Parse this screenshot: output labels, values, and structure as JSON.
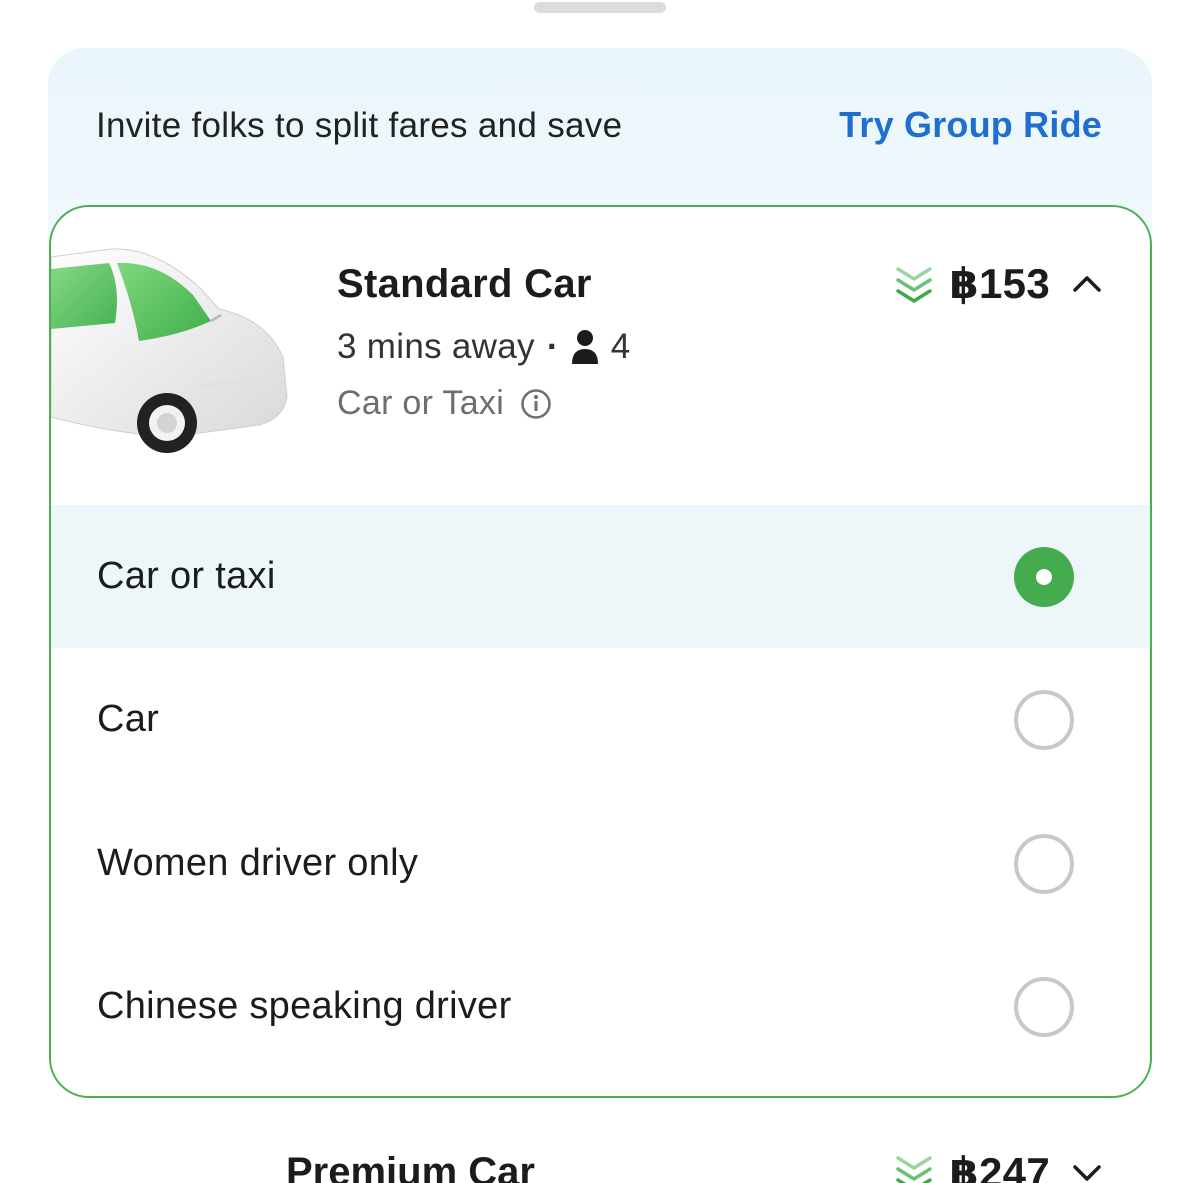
{
  "banner": {
    "text": "Invite folks to split fares and save",
    "link": "Try Group Ride"
  },
  "selected_ride": {
    "name": "Standard Car",
    "eta": "3 mins away",
    "separator": "·",
    "seats": "4",
    "category": "Car or Taxi",
    "price": "฿153",
    "expanded": true,
    "options": [
      {
        "label": "Car or taxi",
        "selected": true
      },
      {
        "label": "Car",
        "selected": false
      },
      {
        "label": "Women driver only",
        "selected": false
      },
      {
        "label": "Chinese speaking driver",
        "selected": false
      }
    ]
  },
  "next_ride": {
    "name": "Premium Car",
    "price": "฿247"
  },
  "colors": {
    "accent_green": "#4caf50",
    "link_blue": "#1e6fd0",
    "banner_bg": "#eaf5fb",
    "selected_row_bg": "#edf7fa"
  },
  "icons": {
    "person": "person-icon",
    "info": "info-icon",
    "fare_trend": "triple-chevron-down-icon",
    "collapse": "chevron-up-icon",
    "expand": "chevron-down-icon"
  }
}
